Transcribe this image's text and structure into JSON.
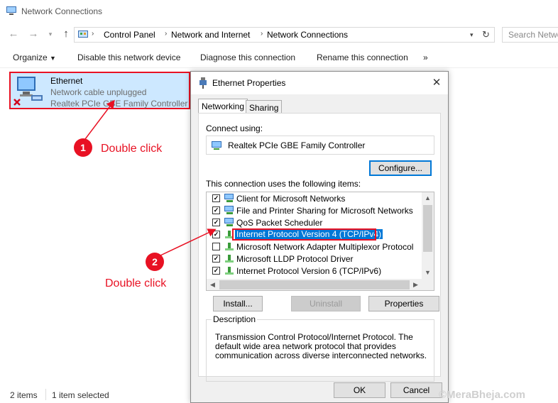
{
  "window": {
    "title": "Network Connections"
  },
  "address": {
    "crumbs": [
      "Control Panel",
      "Network and Internet",
      "Network Connections"
    ],
    "search_placeholder": "Search Network Connections"
  },
  "command_bar": {
    "organize": "Organize",
    "disable": "Disable this network device",
    "diagnose": "Diagnose this connection",
    "rename": "Rename this connection",
    "more": "»"
  },
  "connection": {
    "name": "Ethernet",
    "status": "Network cable unplugged",
    "device": "Realtek PCIe GBE Family Controller"
  },
  "status_bar": {
    "items": "2 items",
    "selected": "1 item selected"
  },
  "annotations": {
    "step1": {
      "num": "1",
      "label": "Double click"
    },
    "step2": {
      "num": "2",
      "label": "Double click"
    }
  },
  "dialog": {
    "title": "Ethernet Properties",
    "tabs": [
      "Networking",
      "Sharing"
    ],
    "connect_using_label": "Connect using:",
    "adapter": "Realtek PCIe GBE Family Controller",
    "configure_button": "Configure...",
    "items_label": "This connection uses the following items:",
    "items": [
      {
        "label": "Client for Microsoft Networks",
        "checked": true,
        "icon": "network-client-icon"
      },
      {
        "label": "File and Printer Sharing for Microsoft Networks",
        "checked": true,
        "icon": "network-service-icon"
      },
      {
        "label": "QoS Packet Scheduler",
        "checked": true,
        "icon": "network-service-icon"
      },
      {
        "label": "Internet Protocol Version 4 (TCP/IPv4)",
        "checked": true,
        "icon": "protocol-icon",
        "selected": true
      },
      {
        "label": "Microsoft Network Adapter Multiplexor Protocol",
        "checked": false,
        "icon": "protocol-icon"
      },
      {
        "label": "Microsoft LLDP Protocol Driver",
        "checked": true,
        "icon": "protocol-icon"
      },
      {
        "label": "Internet Protocol Version 6 (TCP/IPv6)",
        "checked": true,
        "icon": "protocol-icon"
      }
    ],
    "install_button": "Install...",
    "uninstall_button": "Uninstall",
    "properties_button": "Properties",
    "description_legend": "Description",
    "description_text": "Transmission Control Protocol/Internet Protocol. The default wide area network protocol that provides communication across diverse interconnected networks.",
    "ok_button": "OK",
    "cancel_button": "Cancel"
  },
  "watermark": "©MeraBheja.com",
  "colors": {
    "accent": "#0078d7",
    "annotation_red": "#e81123",
    "selection_bg": "#cde8ff"
  }
}
